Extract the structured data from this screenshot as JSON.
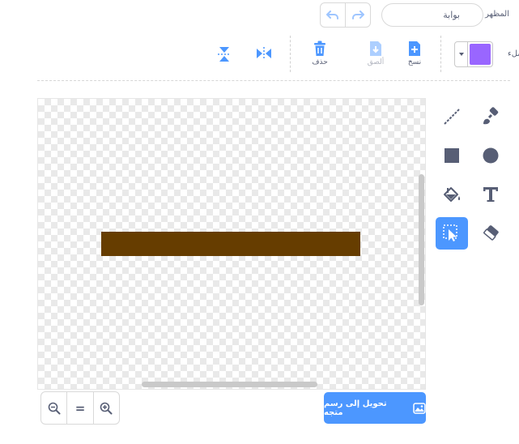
{
  "header": {
    "costume_label": "المظهر",
    "costume_name": "بوابة"
  },
  "toolbar": {
    "fill_label": "ملء",
    "fill_color": "#9966ff",
    "copy_label": "نسخ",
    "paste_label": "ألصق",
    "delete_label": "حذف"
  },
  "canvas": {
    "shape_color": "#663d00"
  },
  "footer": {
    "convert_label": "تحويل إلى رسم متجه",
    "zoom_reset_label": "="
  },
  "colors": {
    "accent": "#4c97ff",
    "icon_dark": "#575e75"
  }
}
